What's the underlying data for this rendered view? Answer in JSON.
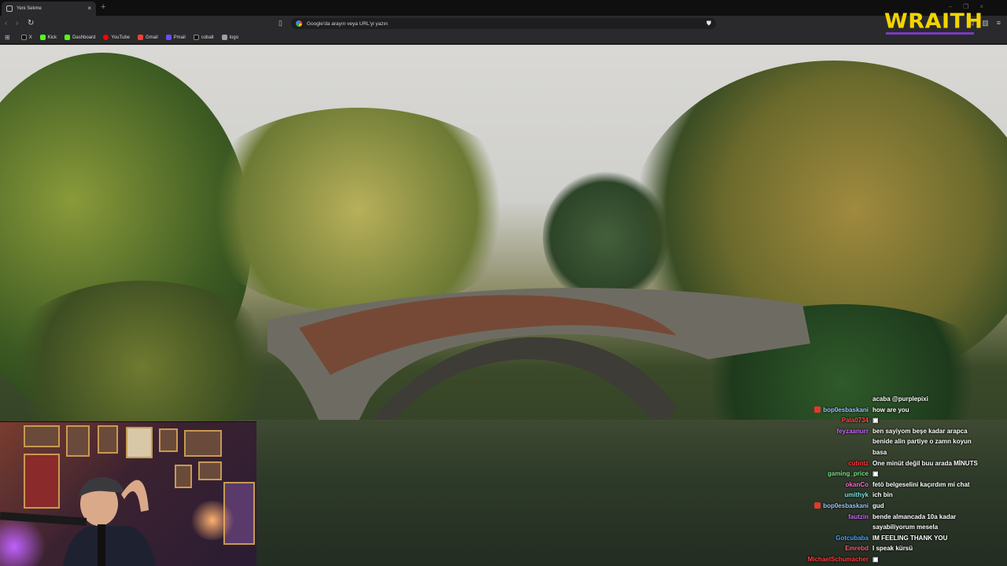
{
  "browser": {
    "tab": {
      "title": "Yeni Sekme",
      "close_glyph": "×"
    },
    "new_tab_glyph": "+",
    "window_controls": [
      "–",
      "❐",
      "×"
    ],
    "nav": {
      "back": "‹",
      "forward": "›",
      "reload": "↻"
    },
    "omnibox": {
      "placeholder": "Google'da arayın veya URL'yi yazın",
      "shield_icon": "brave-shield-icon"
    },
    "bookmarks": [
      {
        "label": "X",
        "color": "#ffffff",
        "icon": "x-icon"
      },
      {
        "label": "Kick",
        "color": "#53fc18",
        "icon": "kick-icon"
      },
      {
        "label": "Dashboard",
        "color": "#53fc18",
        "icon": "kick-dashboard-icon"
      },
      {
        "label": "YouTube",
        "color": "#ff0000",
        "icon": "youtube-icon"
      },
      {
        "label": "Gmail",
        "color": "#ea4335",
        "icon": "gmail-icon"
      },
      {
        "label": "Pmail",
        "color": "#6d4aff",
        "icon": "proton-mail-icon"
      },
      {
        "label": "cobalt",
        "color": "#222222",
        "icon": "cobalt-icon"
      },
      {
        "label": "logo",
        "color": "#9aa0a6",
        "icon": "page-icon"
      }
    ]
  },
  "overlay": {
    "logo_text": "WRAITH",
    "logo_color": "#f3d400",
    "chat": [
      {
        "user": "",
        "user_color": "#ffffff",
        "text": "acaba @purplepixi",
        "badge": false
      },
      {
        "user": "bop0esbaskani",
        "user_color": "#9ec8ff",
        "text": "how are you",
        "badge": true
      },
      {
        "user": "Pala0734",
        "user_color": "#ff4a4a",
        "text": "▣",
        "badge": false
      },
      {
        "user": "feyzaanurr",
        "user_color": "#c86cff",
        "text": "ben sayiyom beşe kadar arapca",
        "badge": false
      },
      {
        "user": "",
        "user_color": "#ffffff",
        "text": "benide alin partiye o zamn koyun",
        "badge": false
      },
      {
        "user": "",
        "user_color": "#ffffff",
        "text": "basa",
        "badge": false
      },
      {
        "user": "cubntz",
        "user_color": "#ff3b3b",
        "text": "One minüt değil buu arada MİNUTS",
        "badge": false
      },
      {
        "user": "gaming_price",
        "user_color": "#7ee08a",
        "text": "▣",
        "badge": false
      },
      {
        "user": "okanCo",
        "user_color": "#ff6bd6",
        "text": "fetö belgeselini kaçırdım mi chat",
        "badge": false
      },
      {
        "user": "umithyk",
        "user_color": "#7ee0e0",
        "text": "ich bin",
        "badge": false
      },
      {
        "user": "bop0esbaskani",
        "user_color": "#9ec8ff",
        "text": "gud",
        "badge": true
      },
      {
        "user": "fautzin",
        "user_color": "#c86cff",
        "text": "bende almancada 10a kadar",
        "badge": false
      },
      {
        "user": "",
        "user_color": "#ffffff",
        "text": "sayabiliyorum mesela",
        "badge": false
      },
      {
        "user": "Gotcubaba",
        "user_color": "#4aa3ff",
        "text": "IM FEELING THANK YOU",
        "badge": false
      },
      {
        "user": "Emrebd",
        "user_color": "#ff5a7a",
        "text": "I speak kürsü",
        "badge": false
      },
      {
        "user": "MichaelSchumacher",
        "user_color": "#ff3b3b",
        "text": "▣",
        "badge": false
      }
    ]
  }
}
